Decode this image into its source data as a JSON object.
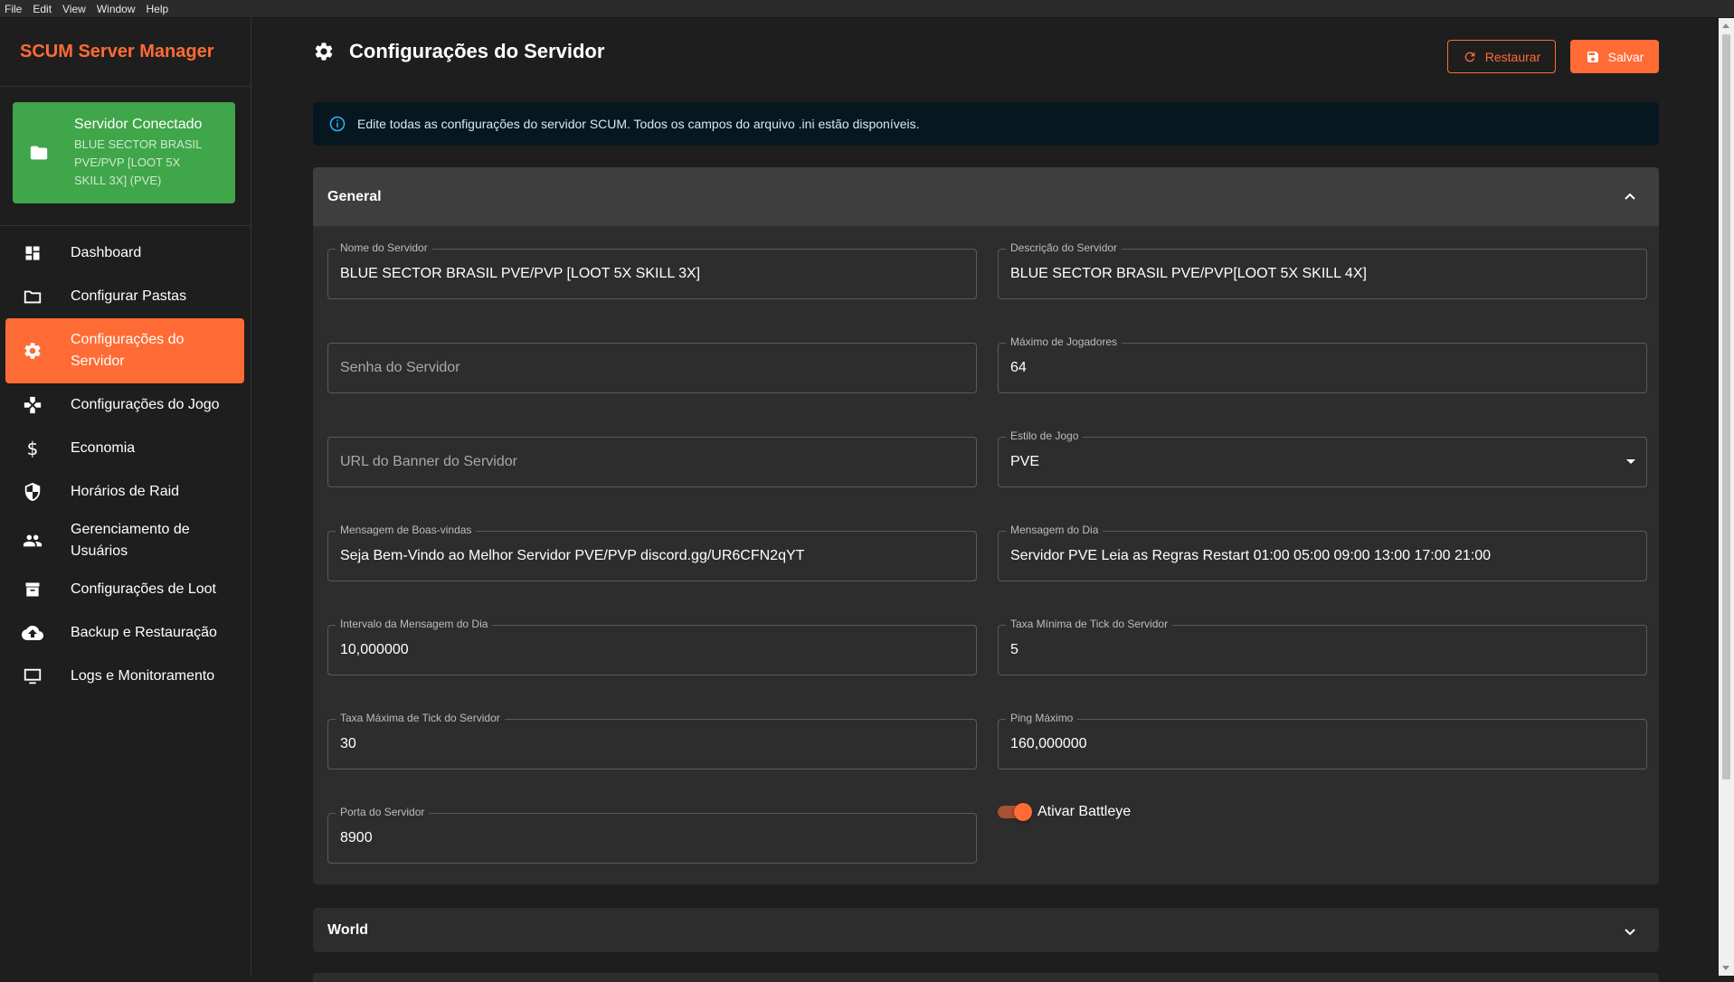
{
  "menubar": {
    "items": [
      "File",
      "Edit",
      "View",
      "Window",
      "Help"
    ]
  },
  "sidebar": {
    "brand": "SCUM Server Manager",
    "connection": {
      "title": "Servidor Conectado",
      "line1": "BLUE SECTOR BRASIL",
      "line2": "PVE/PVP [LOOT 5X",
      "line3": "SKILL 3X] (PVE)"
    },
    "items": [
      {
        "label": "Dashboard",
        "icon": "dashboard-icon"
      },
      {
        "label": "Configurar Pastas",
        "icon": "folder-icon"
      },
      {
        "label1": "Configurações do",
        "label2": "Servidor",
        "icon": "gear-icon",
        "active": true
      },
      {
        "label": "Configurações do Jogo",
        "icon": "gamepad-icon"
      },
      {
        "label": "Economia",
        "icon": "dollar-icon"
      },
      {
        "label": "Horários de Raid",
        "icon": "shield-icon"
      },
      {
        "label1": "Gerenciamento de",
        "label2": "Usuários",
        "icon": "people-icon"
      },
      {
        "label": "Configurações de Loot",
        "icon": "archive-icon"
      },
      {
        "label": "Backup e Restauração",
        "icon": "cloud-upload-icon"
      },
      {
        "label": "Logs e Monitoramento",
        "icon": "monitor-icon"
      }
    ]
  },
  "header": {
    "title": "Configurações do Servidor",
    "restore_label": "Restaurar",
    "save_label": "Salvar"
  },
  "info": {
    "text": "Edite todas as configurações do servidor SCUM. Todos os campos do arquivo .ini estão disponíveis."
  },
  "general": {
    "title": "General",
    "fields": {
      "server_name": {
        "label": "Nome do Servidor",
        "value": "BLUE SECTOR BRASIL PVE/PVP [LOOT 5X SKILL 3X]"
      },
      "server_description": {
        "label": "Descrição do Servidor",
        "value": "BLUE SECTOR BRASIL PVE/PVP[LOOT 5X SKILL 4X]"
      },
      "server_password": {
        "placeholder": "Senha do Servidor"
      },
      "max_players": {
        "label": "Máximo de Jogadores",
        "value": "64"
      },
      "banner_url": {
        "placeholder": "URL do Banner do Servidor"
      },
      "game_style": {
        "label": "Estilo de Jogo",
        "value": "PVE"
      },
      "welcome_message": {
        "label": "Mensagem de Boas-vindas",
        "value": "Seja Bem-Vindo ao Melhor Servidor PVE/PVP  discord.gg/UR6CFN2qYT"
      },
      "motd": {
        "label": "Mensagem do Dia",
        "value": "Servidor PVE Leia as Regras Restart  01:00 05:00 09:00 13:00 17:00 21:00"
      },
      "motd_interval": {
        "label": "Intervalo da Mensagem do Dia",
        "value": "10,000000"
      },
      "min_tick": {
        "label": "Taxa Mínima de Tick do Servidor",
        "value": "5"
      },
      "max_tick": {
        "label": "Taxa Máxima de Tick do Servidor",
        "value": "30"
      },
      "max_ping": {
        "label": "Ping Máximo",
        "value": "160,000000"
      },
      "server_port": {
        "label": "Porta do Servidor",
        "value": "8900"
      }
    },
    "battleye": {
      "label": "Ativar Battleye",
      "enabled": true
    }
  },
  "world": {
    "title": "World"
  },
  "colors": {
    "accent": "#ff6b35",
    "connected": "#3fa64a",
    "panel": "#2d2d2d",
    "panel_header": "#3e3e3e",
    "info_bg": "#071720"
  }
}
